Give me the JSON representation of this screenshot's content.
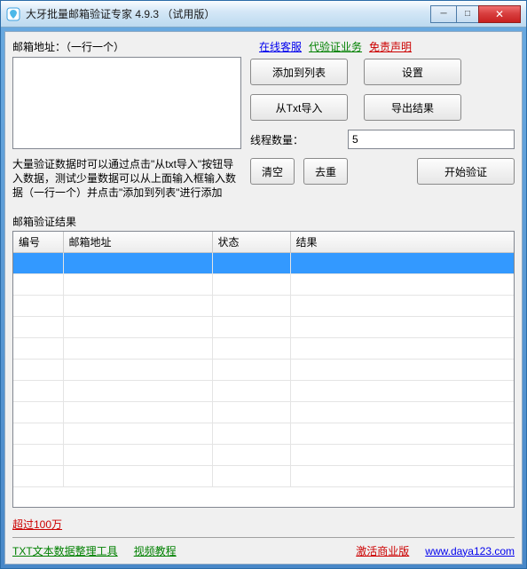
{
  "window": {
    "title": "大牙批量邮箱验证专家 4.9.3 （试用版）"
  },
  "input": {
    "label": "邮箱地址：（一行一个）",
    "value": ""
  },
  "top_links": {
    "online_service": "在线客服",
    "proxy_service": "代验证业务",
    "disclaimer": "免责声明"
  },
  "buttons": {
    "add_to_list": "添加到列表",
    "settings": "设置",
    "import_txt": "从Txt导入",
    "export_result": "导出结果",
    "clear": "清空",
    "dedup": "去重",
    "start_verify": "开始验证"
  },
  "thread": {
    "label": "线程数量：",
    "value": "5"
  },
  "hint": "大量验证数据时可以通过点击\"从txt导入\"按钮导入数据，测试少量数据可以从上面输入框输入数据（一行一个）并点击\"添加到列表\"进行添加",
  "table": {
    "title": "邮箱验证结果",
    "headers": {
      "no": "编号",
      "addr": "邮箱地址",
      "status": "状态",
      "result": "结果"
    },
    "rows": [
      {
        "selected": true
      },
      {},
      {},
      {},
      {},
      {},
      {},
      {},
      {},
      {},
      {}
    ]
  },
  "footer": {
    "over_million": "超过100万",
    "txt_tool": "TXT文本数据整理工具",
    "video_tutorial": "视频教程",
    "activate": "激活商业版",
    "site": "www.daya123.com"
  }
}
